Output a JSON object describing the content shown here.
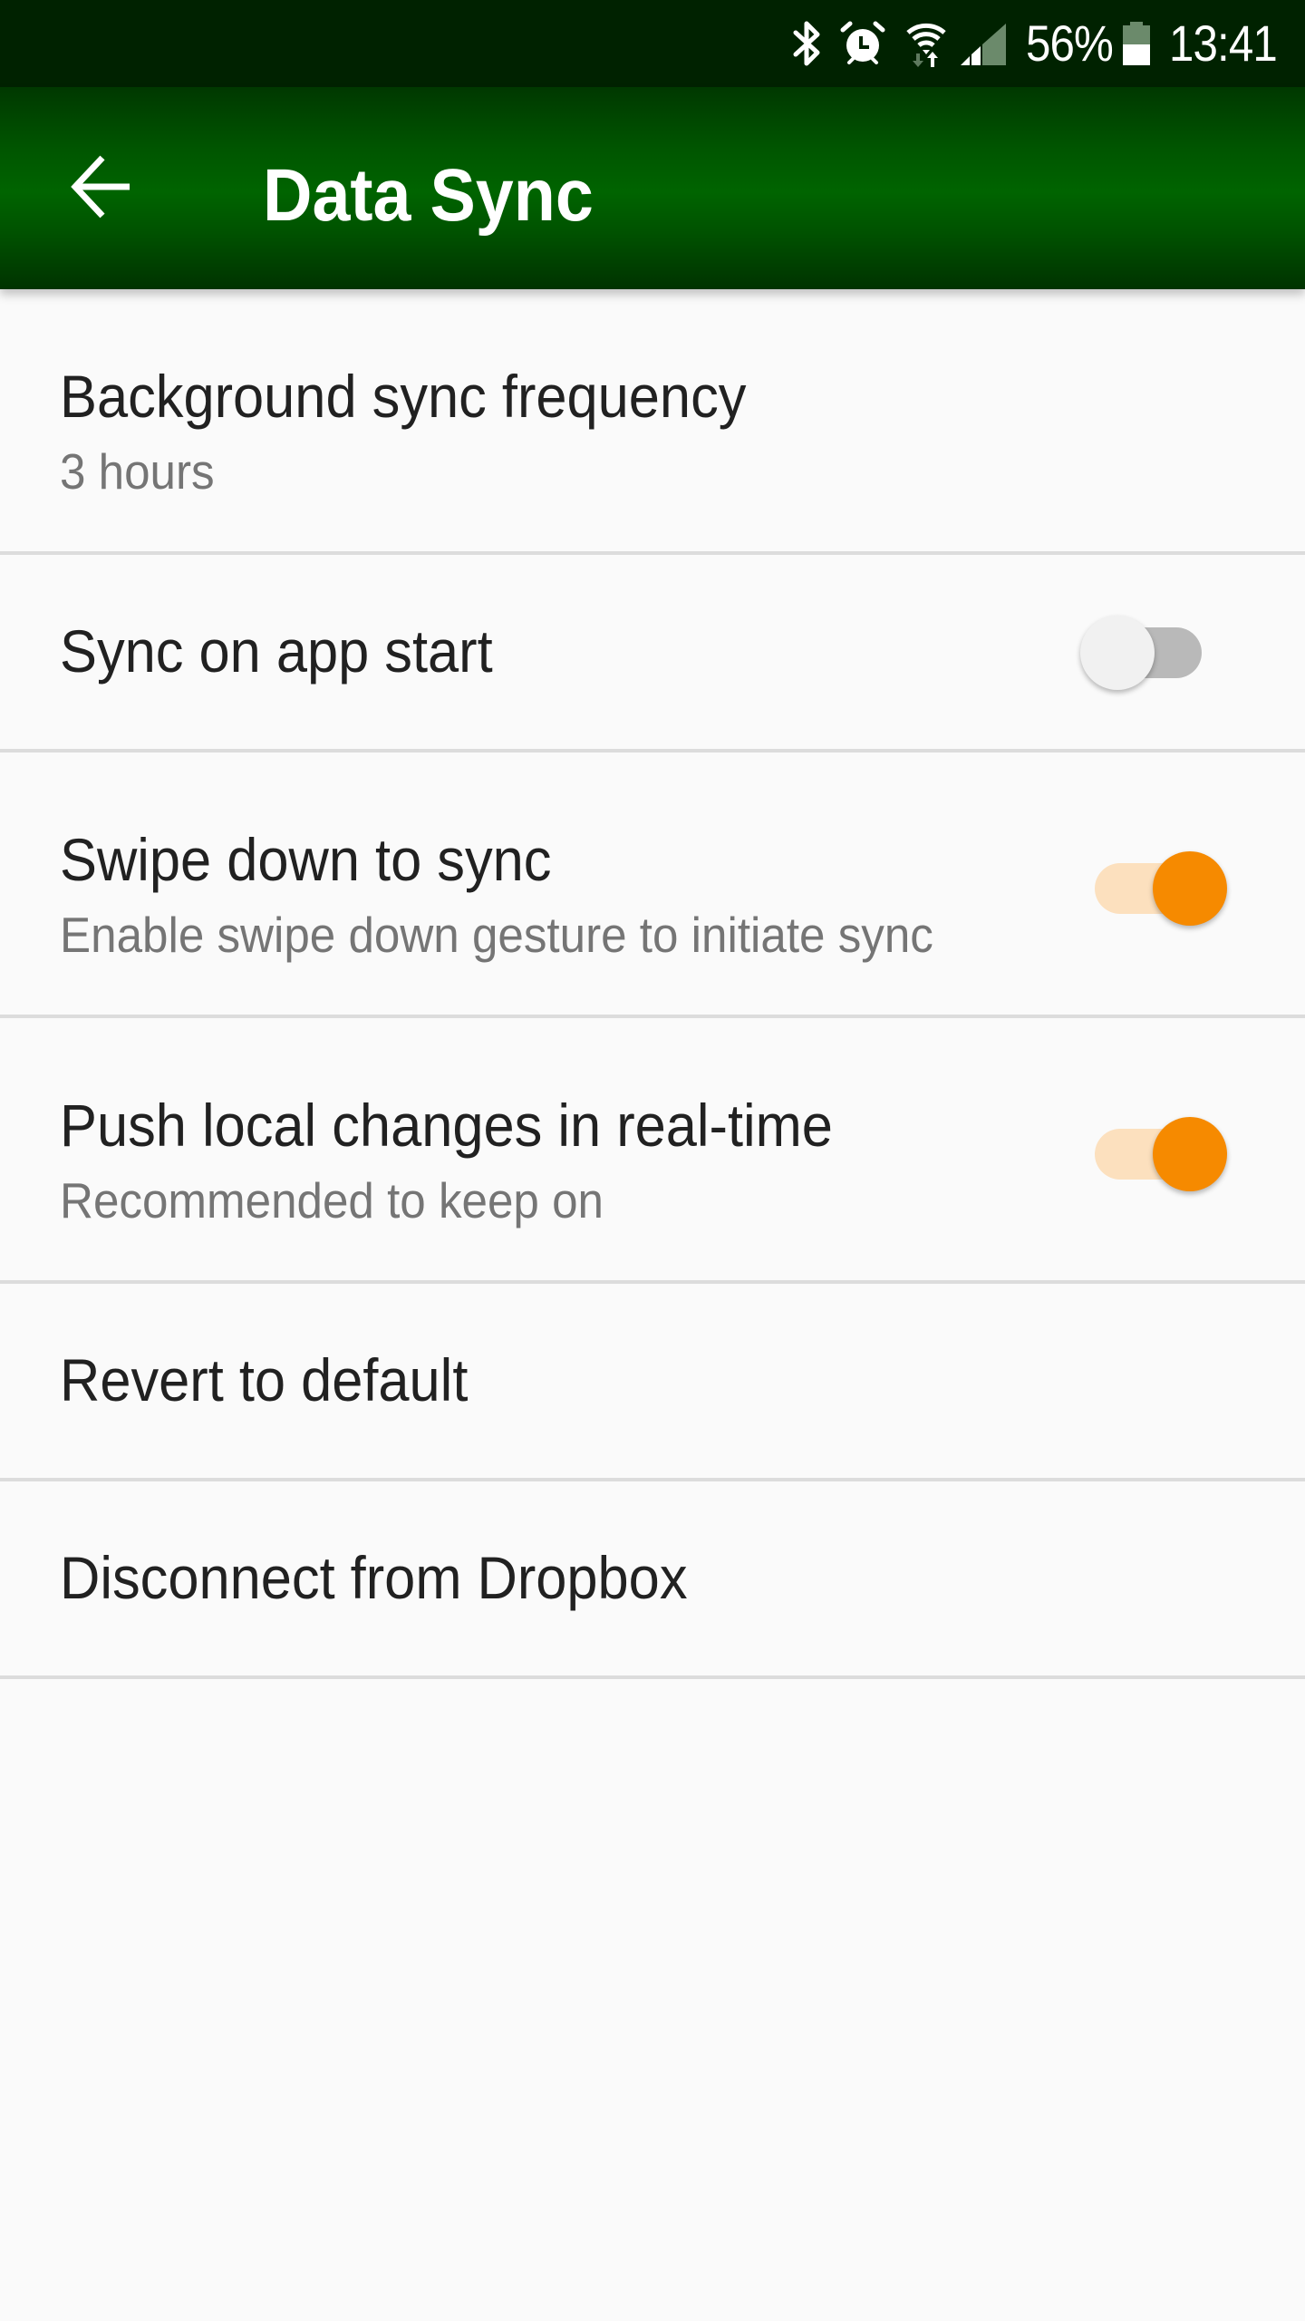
{
  "status_bar": {
    "icons": [
      "bluetooth-icon",
      "alarm-icon",
      "wifi-icon",
      "cell-signal-icon",
      "battery-icon"
    ],
    "battery_percent": "56%",
    "time": "13:41"
  },
  "app_bar": {
    "back_icon": "arrow-left-icon",
    "title": "Data Sync",
    "color": "#006400"
  },
  "settings": [
    {
      "title": "Background sync frequency",
      "summary": "3 hours",
      "type": "list"
    },
    {
      "title": "Sync on app start",
      "type": "switch",
      "checked": false
    },
    {
      "title": "Swipe down to sync",
      "summary": "Enable swipe down gesture to initiate sync",
      "type": "switch",
      "checked": true
    },
    {
      "title": "Push local changes in real-time",
      "summary": "Recommended to keep on",
      "type": "switch",
      "checked": true
    },
    {
      "title": "Revert to default",
      "type": "action"
    },
    {
      "title": "Disconnect from Dropbox",
      "type": "action"
    }
  ],
  "colors": {
    "accent": "#F68A00",
    "accent_track": "#FCE0BE",
    "status_bar": "#002200",
    "title_text": "#212121",
    "summary_text": "#757575",
    "divider": "#DCDCDC",
    "background": "#FAFAFA"
  }
}
